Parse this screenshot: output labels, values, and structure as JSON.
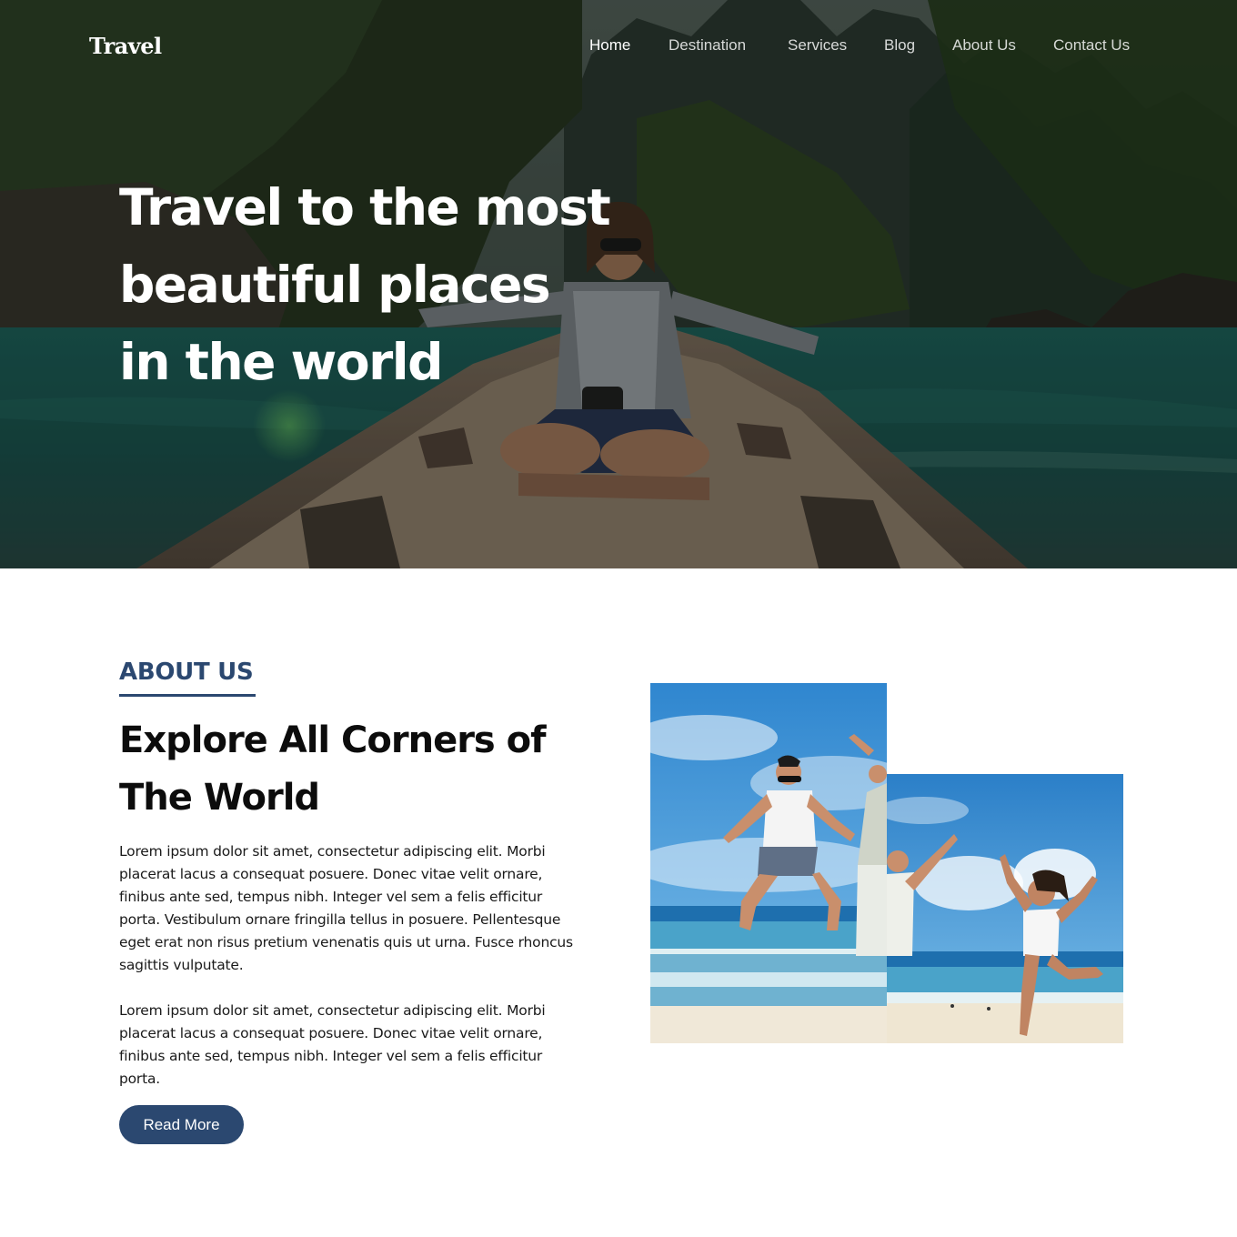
{
  "header": {
    "logo": "Travel",
    "nav": [
      {
        "label": "Home",
        "active": true
      },
      {
        "label": "Destination",
        "active": false
      },
      {
        "label": "Services",
        "active": false
      },
      {
        "label": "Blog",
        "active": false
      },
      {
        "label": "About Us",
        "active": false
      },
      {
        "label": "Contact Us",
        "active": false
      }
    ]
  },
  "hero": {
    "title_lines": [
      "Travel to the most",
      "beautiful places",
      "in the world"
    ]
  },
  "about": {
    "kicker": "ABOUT US",
    "title_lines": [
      "Explore All Corners of",
      "The World"
    ],
    "paragraph1": "Lorem ipsum dolor sit amet, consectetur adipiscing elit. Morbi placerat lacus a consequat posuere. Donec vitae velit ornare, finibus ante sed, tempus nibh. Integer vel sem a felis efficitur porta. Vestibulum ornare fringilla tellus in posuere. Pellentesque eget erat non risus pretium venenatis quis ut urna. Fusce rhoncus sagittis vulputate.",
    "paragraph2": "Lorem ipsum dolor sit amet, consectetur adipiscing elit. Morbi placerat lacus a consequat posuere. Donec vitae velit ornare, finibus ante sed, tempus nibh. Integer vel sem a felis efficitur porta.",
    "button_label": "Read More"
  },
  "colors": {
    "accent": "#2b4870",
    "text": "#0c0c0c",
    "nav_text": "#ffffff"
  }
}
